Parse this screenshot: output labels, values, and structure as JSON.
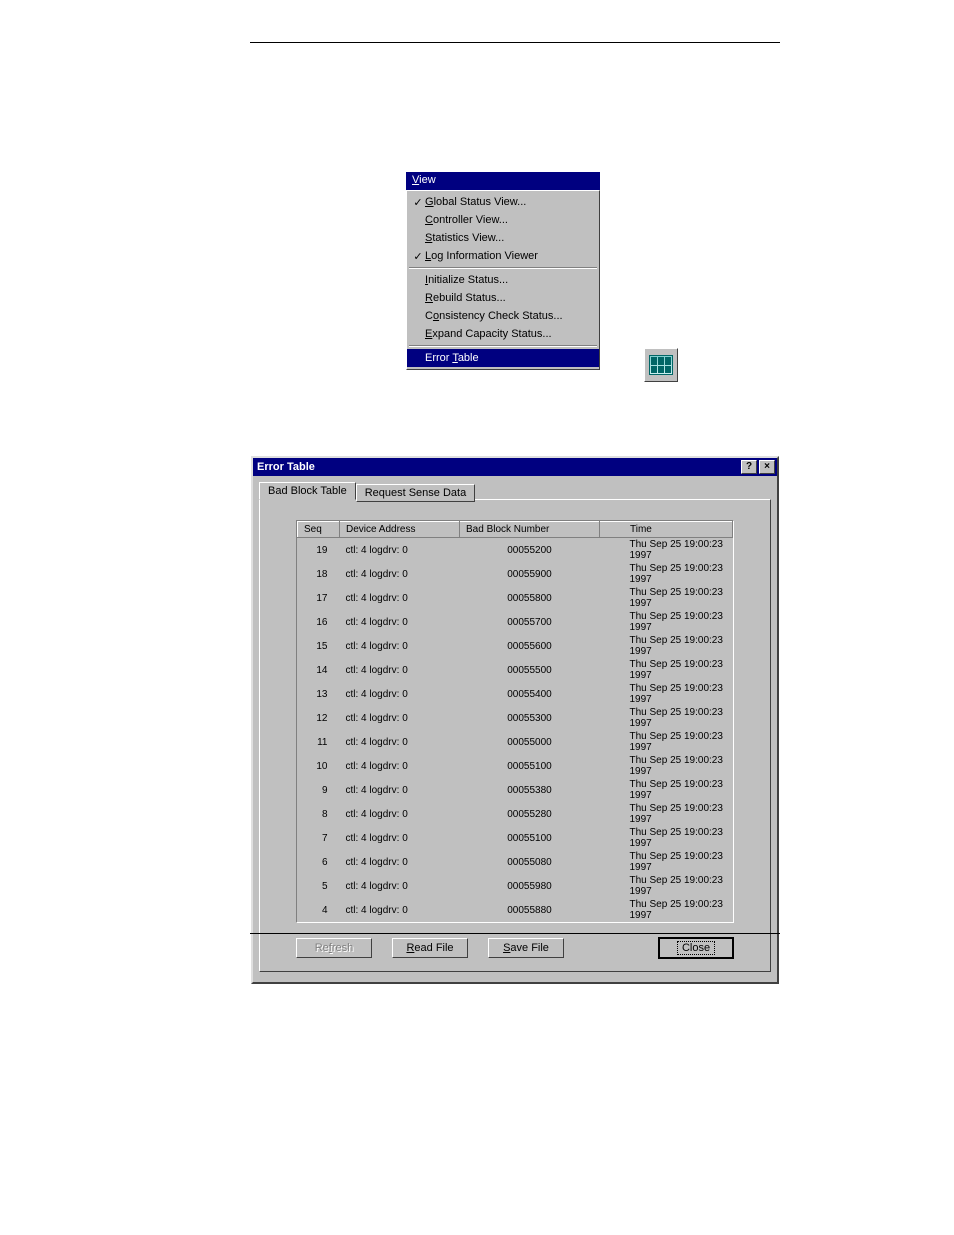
{
  "menu": {
    "title_pre": "V",
    "title_post": "iew",
    "items_g1": [
      {
        "checked": true,
        "pre": "",
        "u": "G",
        "post": "lobal Status View..."
      },
      {
        "checked": false,
        "pre": "",
        "u": "C",
        "post": "ontroller View..."
      },
      {
        "checked": false,
        "pre": "",
        "u": "S",
        "post": "tatistics View..."
      },
      {
        "checked": true,
        "pre": "",
        "u": "L",
        "post": "og Information Viewer"
      }
    ],
    "items_g2": [
      {
        "checked": false,
        "pre": "",
        "u": "I",
        "post": "nitialize Status..."
      },
      {
        "checked": false,
        "pre": "",
        "u": "R",
        "post": "ebuild Status..."
      },
      {
        "checked": false,
        "pre": "C",
        "u": "o",
        "post": "nsistency Check Status..."
      },
      {
        "checked": false,
        "pre": "",
        "u": "E",
        "post": "xpand Capacity Status..."
      }
    ],
    "selected": {
      "pre": "Error ",
      "u": "T",
      "post": "able"
    }
  },
  "dialog": {
    "title": "Error Table",
    "help_glyph": "?",
    "close_glyph": "×",
    "tabs": [
      {
        "label": "Bad Block Table",
        "active": true
      },
      {
        "label": "Request Sense Data",
        "active": false
      }
    ],
    "columns": {
      "seq": "Seq",
      "dev": "Device Address",
      "bbn": "Bad Block Number",
      "time": "Time"
    },
    "rows": [
      {
        "seq": "19",
        "dev": "ctl: 4 logdrv: 0",
        "bbn": "00055200",
        "time": "Thu Sep 25 19:00:23 1997"
      },
      {
        "seq": "18",
        "dev": "ctl: 4 logdrv: 0",
        "bbn": "00055900",
        "time": "Thu Sep 25 19:00:23 1997"
      },
      {
        "seq": "17",
        "dev": "ctl: 4 logdrv: 0",
        "bbn": "00055800",
        "time": "Thu Sep 25 19:00:23 1997"
      },
      {
        "seq": "16",
        "dev": "ctl: 4 logdrv: 0",
        "bbn": "00055700",
        "time": "Thu Sep 25 19:00:23 1997"
      },
      {
        "seq": "15",
        "dev": "ctl: 4 logdrv: 0",
        "bbn": "00055600",
        "time": "Thu Sep 25 19:00:23 1997"
      },
      {
        "seq": "14",
        "dev": "ctl: 4 logdrv: 0",
        "bbn": "00055500",
        "time": "Thu Sep 25 19:00:23 1997"
      },
      {
        "seq": "13",
        "dev": "ctl: 4 logdrv: 0",
        "bbn": "00055400",
        "time": "Thu Sep 25 19:00:23 1997"
      },
      {
        "seq": "12",
        "dev": "ctl: 4 logdrv: 0",
        "bbn": "00055300",
        "time": "Thu Sep 25 19:00:23 1997"
      },
      {
        "seq": "11",
        "dev": "ctl: 4 logdrv: 0",
        "bbn": "00055000",
        "time": "Thu Sep 25 19:00:23 1997"
      },
      {
        "seq": "10",
        "dev": "ctl: 4 logdrv: 0",
        "bbn": "00055100",
        "time": "Thu Sep 25 19:00:23 1997"
      },
      {
        "seq": "9",
        "dev": "ctl: 4 logdrv: 0",
        "bbn": "00055380",
        "time": "Thu Sep 25 19:00:23 1997"
      },
      {
        "seq": "8",
        "dev": "ctl: 4 logdrv: 0",
        "bbn": "00055280",
        "time": "Thu Sep 25 19:00:23 1997"
      },
      {
        "seq": "7",
        "dev": "ctl: 4 logdrv: 0",
        "bbn": "00055100",
        "time": "Thu Sep 25 19:00:23 1997"
      },
      {
        "seq": "6",
        "dev": "ctl: 4 logdrv: 0",
        "bbn": "00055080",
        "time": "Thu Sep 25 19:00:23 1997"
      },
      {
        "seq": "5",
        "dev": "ctl: 4 logdrv: 0",
        "bbn": "00055980",
        "time": "Thu Sep 25 19:00:23 1997"
      },
      {
        "seq": "4",
        "dev": "ctl: 4 logdrv: 0",
        "bbn": "00055880",
        "time": "Thu Sep 25 19:00:23 1997"
      }
    ],
    "buttons": {
      "refresh": {
        "pre": "Re",
        "u": "f",
        "post": "resh"
      },
      "readfile": {
        "u": "R",
        "post": "ead File"
      },
      "savefile": {
        "u": "S",
        "post": "ave File"
      },
      "close": {
        "label": "Close"
      }
    }
  }
}
